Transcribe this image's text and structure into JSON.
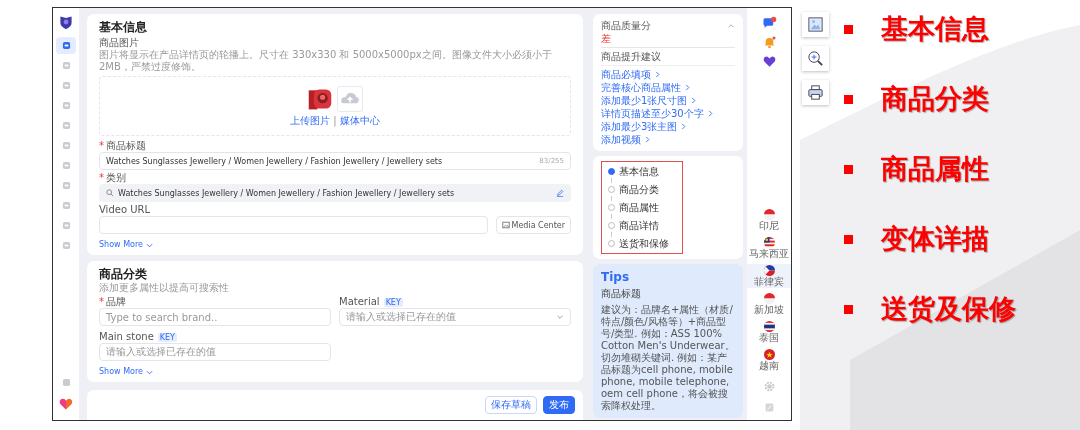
{
  "sidebar": {
    "items": [
      {
        "selected": true
      },
      {
        "selected": false
      },
      {
        "selected": false
      },
      {
        "selected": false
      },
      {
        "selected": false
      },
      {
        "selected": false
      },
      {
        "selected": false
      },
      {
        "selected": false
      },
      {
        "selected": false
      },
      {
        "selected": false
      },
      {
        "selected": false
      }
    ]
  },
  "basic_info": {
    "title": "基本信息",
    "image_label": "商品图片",
    "image_hint": "图片将显示在产品详情页的轮播上。尺寸在 330x330 和 5000x5000px之间。图像文件大小必须小于 2MB，严禁过度修饰。",
    "upload_links": [
      "上传图片",
      "媒体中心"
    ],
    "upload_separator": "|",
    "title_field": {
      "label": "商品标题",
      "marker": "*",
      "value": "Watches Sunglasses Jewellery / Women Jewellery / Fashion Jewellery / Jewellery sets",
      "counter": "83/255"
    },
    "category_field": {
      "label": "类别",
      "marker": "*",
      "value": "Watches Sunglasses Jewellery / Women Jewellery / Fashion Jewellery / Jewellery sets"
    },
    "video_field": {
      "label": "Video URL",
      "button": "Media Center"
    },
    "show_more": "Show More"
  },
  "classification": {
    "title": "商品分类",
    "subtitle": "添加更多属性以提高可搜索性",
    "show_more": "Show More",
    "fields": [
      {
        "label": "品牌",
        "marker": "*",
        "placeholder": "Type to search brand..",
        "kind": "text"
      },
      {
        "label": "Material",
        "key_tag": "KEY",
        "placeholder": "请输入或选择已存在的值",
        "kind": "select"
      },
      {
        "label": "Main stone",
        "key_tag": "KEY",
        "placeholder": "请输入或选择已存在的值",
        "kind": "text"
      }
    ]
  },
  "footer": {
    "buttons": [
      {
        "label": "保存草稿",
        "kind": "secondary"
      },
      {
        "label": "发布",
        "kind": "primary"
      }
    ]
  },
  "quality": {
    "title": "商品质量分",
    "expanded": true,
    "grade": "差",
    "suggestion_title": "商品提升建议",
    "suggestions": [
      "商品必填项",
      "完善核心商品属性",
      "添加最少1张尺寸图",
      "详情页描述至少30个字",
      "添加最少3张主图",
      "添加视频"
    ]
  },
  "nav": {
    "highlighted": true,
    "items": [
      {
        "label": "基本信息",
        "selected": true
      },
      {
        "label": "商品分类",
        "selected": false
      },
      {
        "label": "商品属性",
        "selected": false
      },
      {
        "label": "商品详情",
        "selected": false
      },
      {
        "label": "送货和保修",
        "selected": false
      }
    ]
  },
  "tips": {
    "title": "Tips",
    "subtitle": "商品标题",
    "text": "建议为：品牌名+属性（材质/特点/颜色/风格等）+商品型号/类型. 例如：ASS 100% Cotton Men's Underwear。切勿堆砌关键词. 例如：某产品标题为cell phone, mobile phone, mobile telephone, oem cell phone，将会被搜索降权处理。"
  },
  "regions": [
    {
      "label": "印尼",
      "kind": "id",
      "selected": false
    },
    {
      "label": "马来西亚",
      "kind": "my",
      "selected": false
    },
    {
      "label": "菲律宾",
      "kind": "ph",
      "selected": true
    },
    {
      "label": "新加坡",
      "kind": "sg",
      "selected": false
    },
    {
      "label": "泰国",
      "kind": "th",
      "selected": false
    },
    {
      "label": "越南",
      "kind": "vn",
      "selected": false
    }
  ],
  "slide": {
    "bullets": [
      "基本信息",
      "商品分类",
      "商品属性",
      "变体详描",
      "送货及保修"
    ]
  }
}
